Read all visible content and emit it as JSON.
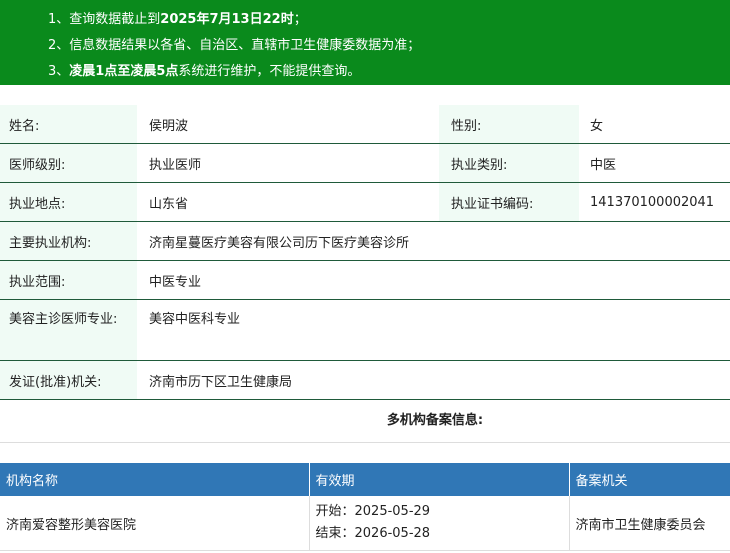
{
  "notice": {
    "line1_prefix": "1、查询数据截止到",
    "line1_bold": "2025年7月13日22时",
    "line1_suffix": "；",
    "line2": "2、信息数据结果以各省、自治区、直辖市卫生健康委数据为准；",
    "line3_prefix": "3、",
    "line3_bold": "凌晨1点至凌晨5点",
    "line3_suffix": "系统进行维护，不能提供查询。"
  },
  "info": {
    "name_label": "姓名:",
    "name_value": "侯明波",
    "gender_label": "性别:",
    "gender_value": "女",
    "level_label": "医师级别:",
    "level_value": "执业医师",
    "category_label": "执业类别:",
    "category_value": "中医",
    "location_label": "执业地点:",
    "location_value": "山东省",
    "cert_label": "执业证书编码:",
    "cert_value": "141370100002041",
    "org_label": "主要执业机构:",
    "org_value": "济南星蔓医疗美容有限公司历下医疗美容诊所",
    "scope_label": "执业范围:",
    "scope_value": "中医专业",
    "beauty_label": "美容主诊医师专业:",
    "beauty_value": "美容中医科专业",
    "issuer_label": "发证(批准)机关:",
    "issuer_value": "济南市历下区卫生健康局"
  },
  "multi": {
    "title": "多机构备案信息:",
    "headers": [
      "机构名称",
      "有效期",
      "备案机关"
    ],
    "rows": [
      {
        "org": "济南爱容整形美容医院",
        "start": "开始：2025-05-29",
        "end": "结束：2026-05-28",
        "authority": "济南市卫生健康委员会"
      }
    ]
  }
}
